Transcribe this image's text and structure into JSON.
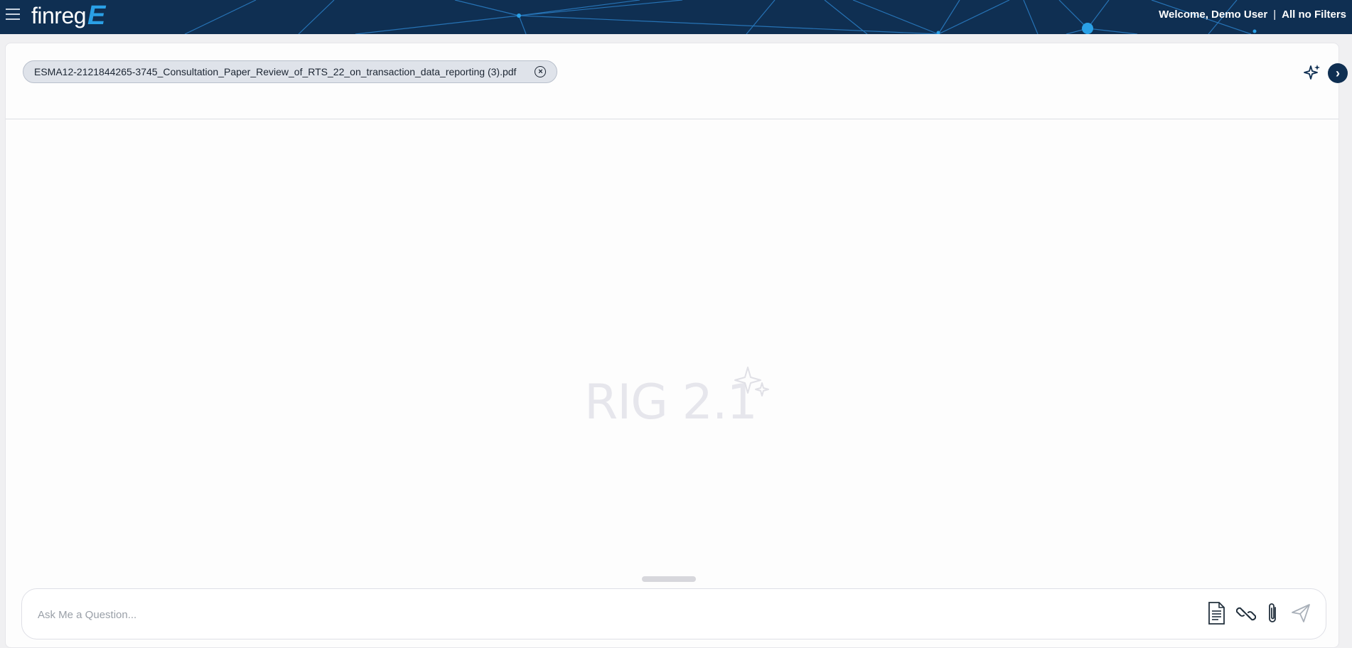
{
  "header": {
    "welcome": "Welcome, Demo User",
    "separator": "|",
    "filter_label": "All no Filters",
    "logo_word": "finreg",
    "logo_letter": "E",
    "colors": {
      "bar": "#0f2f52",
      "accent": "#2aa0e6"
    }
  },
  "attachment": {
    "filename": "ESMA12-2121844265-3745_Consultation_Paper_Review_of_RTS_22_on_transaction_data_reporting (3).pdf"
  },
  "watermark": {
    "text": "RIG 2.1"
  },
  "composer": {
    "placeholder": "Ask Me a Question...",
    "tools": [
      "document-icon",
      "link-icon",
      "paperclip-icon",
      "send-icon"
    ]
  },
  "icons": {
    "menu": "hamburger-icon",
    "assistant": "sparkle-icon",
    "expand": "chevron-right-icon",
    "remove_attachment": "close-circle-icon"
  }
}
